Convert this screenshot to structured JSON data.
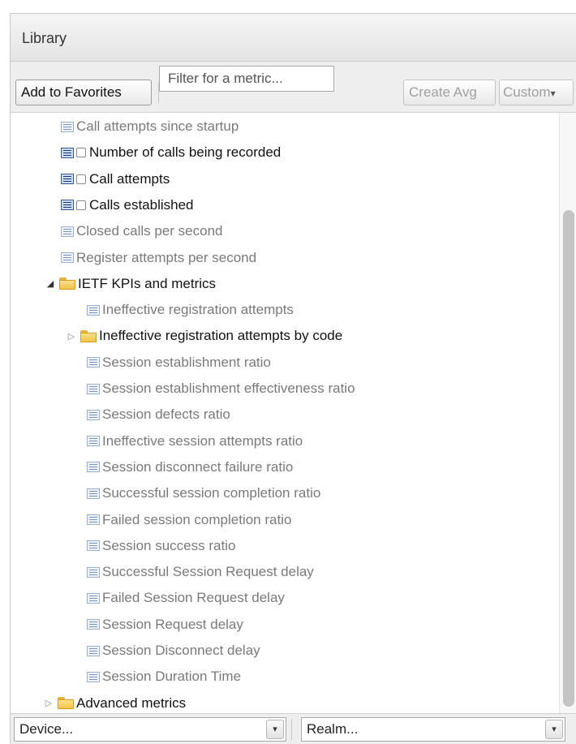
{
  "header": {
    "title": "Library"
  },
  "toolbar": {
    "add_favorites": "Add to Favorites",
    "filter_placeholder": "Filter for a metric...",
    "create_avg": "Create Avg",
    "custom": "Custom",
    "custom_arrow": "▾"
  },
  "tree": [
    {
      "label": "Call attempts since startup",
      "kind": "metric",
      "level": 2,
      "style": "dim",
      "checkbox": false
    },
    {
      "label": "Number of calls being recorded",
      "kind": "metric",
      "level": 2,
      "style": "dark",
      "checkbox": true
    },
    {
      "label": "Call attempts",
      "kind": "metric",
      "level": 2,
      "style": "dark",
      "checkbox": true
    },
    {
      "label": "Calls established",
      "kind": "metric",
      "level": 2,
      "style": "dark",
      "checkbox": true
    },
    {
      "label": "Closed calls per second",
      "kind": "metric",
      "level": 2,
      "style": "dim",
      "checkbox": false
    },
    {
      "label": "Register attempts per second",
      "kind": "metric",
      "level": 2,
      "style": "dim",
      "checkbox": false
    },
    {
      "label": "IETF KPIs and metrics",
      "kind": "folder",
      "level": 1,
      "style": "dark",
      "expanded": true
    },
    {
      "label": "Ineffective registration attempts",
      "kind": "metric",
      "level": 3,
      "style": "dim",
      "checkbox": false
    },
    {
      "label": "Ineffective registration attempts by code",
      "kind": "folder",
      "level": 2,
      "style": "dark",
      "expanded": false
    },
    {
      "label": "Session establishment ratio",
      "kind": "metric",
      "level": 3,
      "style": "dim",
      "checkbox": false
    },
    {
      "label": "Session establishment effectiveness ratio",
      "kind": "metric",
      "level": 3,
      "style": "dim",
      "checkbox": false
    },
    {
      "label": "Session defects ratio",
      "kind": "metric",
      "level": 3,
      "style": "dim",
      "checkbox": false
    },
    {
      "label": "Ineffective session attempts ratio",
      "kind": "metric",
      "level": 3,
      "style": "dim",
      "checkbox": false
    },
    {
      "label": "Session disconnect failure ratio",
      "kind": "metric",
      "level": 3,
      "style": "dim",
      "checkbox": false
    },
    {
      "label": "Successful session completion ratio",
      "kind": "metric",
      "level": 3,
      "style": "dim",
      "checkbox": false
    },
    {
      "label": "Failed session completion ratio",
      "kind": "metric",
      "level": 3,
      "style": "dim",
      "checkbox": false
    },
    {
      "label": "Session success ratio",
      "kind": "metric",
      "level": 3,
      "style": "dim",
      "checkbox": false
    },
    {
      "label": "Successful Session Request delay",
      "kind": "metric",
      "level": 3,
      "style": "dim",
      "checkbox": false
    },
    {
      "label": "Failed Session Request delay",
      "kind": "metric",
      "level": 3,
      "style": "dim",
      "checkbox": false
    },
    {
      "label": "Session Request delay",
      "kind": "metric",
      "level": 3,
      "style": "dim",
      "checkbox": false
    },
    {
      "label": "Session Disconnect delay",
      "kind": "metric",
      "level": 3,
      "style": "dim",
      "checkbox": false
    },
    {
      "label": "Session Duration Time",
      "kind": "metric",
      "level": 3,
      "style": "dim",
      "checkbox": false
    },
    {
      "label": "Advanced metrics",
      "kind": "folder",
      "level": 0,
      "style": "dark",
      "expanded": false
    }
  ],
  "footer": {
    "device": "Device...",
    "realm": "Realm...",
    "arrow": "▾"
  }
}
